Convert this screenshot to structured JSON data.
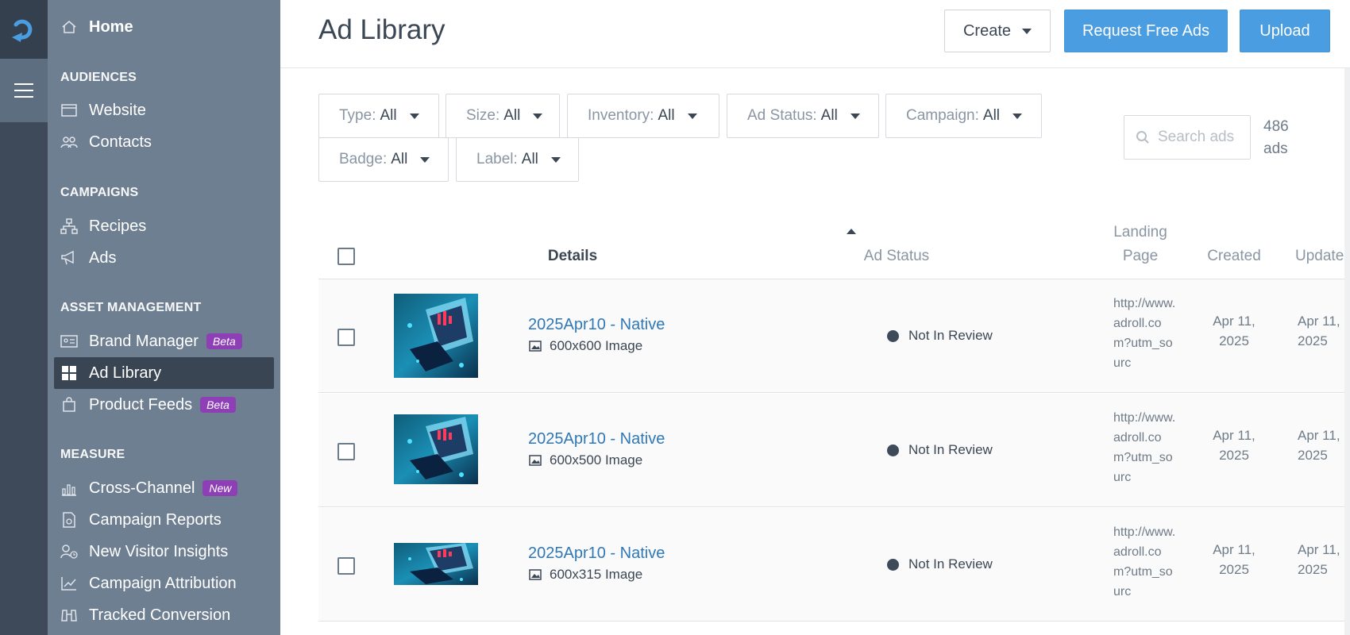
{
  "sidebar": {
    "home": "Home",
    "sections": {
      "audiences": "AUDIENCES",
      "campaigns": "CAMPAIGNS",
      "asset_management": "ASSET MANAGEMENT",
      "measure": "MEASURE"
    },
    "items": {
      "website": "Website",
      "contacts": "Contacts",
      "recipes": "Recipes",
      "ads": "Ads",
      "brand_manager": "Brand Manager",
      "ad_library": "Ad Library",
      "product_feeds": "Product Feeds",
      "cross_channel": "Cross-Channel",
      "campaign_reports": "Campaign Reports",
      "new_visitor_insights": "New Visitor Insights",
      "campaign_attribution": "Campaign Attribution",
      "tracked_conversion": "Tracked Conversion"
    },
    "badges": {
      "beta": "Beta",
      "new": "New"
    }
  },
  "header": {
    "title": "Ad Library",
    "create_label": "Create",
    "request_label": "Request Free Ads",
    "upload_label": "Upload"
  },
  "filters": [
    {
      "label": "Type:",
      "value": "All"
    },
    {
      "label": "Size:",
      "value": "All"
    },
    {
      "label": "Inventory:",
      "value": "All"
    },
    {
      "label": "Ad Status:",
      "value": "All"
    },
    {
      "label": "Campaign:",
      "value": "All"
    },
    {
      "label": "Badge:",
      "value": "All"
    },
    {
      "label": "Label:",
      "value": "All"
    }
  ],
  "search": {
    "placeholder": "Search ads"
  },
  "count": {
    "number": "486",
    "unit": "ads"
  },
  "table": {
    "columns": {
      "details": "Details",
      "status": "Ad Status",
      "landing_1": "Landing",
      "landing_2": "Page",
      "created": "Created",
      "updated": "Updated"
    },
    "rows": [
      {
        "name": "2025Apr10 - Native",
        "type": "600x600 Image",
        "status": "Not In Review",
        "landing": "http://www.adroll.com?utm_sourc",
        "created_1": "Apr 11,",
        "created_2": "2025",
        "updated_1": "Apr 11,",
        "updated_2": "2025"
      },
      {
        "name": "2025Apr10 - Native",
        "type": "600x500 Image",
        "status": "Not In Review",
        "landing": "http://www.adroll.com?utm_sourc",
        "created_1": "Apr 11,",
        "created_2": "2025",
        "updated_1": "Apr 11,",
        "updated_2": "2025"
      },
      {
        "name": "2025Apr10 - Native",
        "type": "600x315 Image",
        "status": "Not In Review",
        "landing": "http://www.adroll.com?utm_sourc",
        "created_1": "Apr 11,",
        "created_2": "2025",
        "updated_1": "Apr 11,",
        "updated_2": "2025"
      }
    ]
  },
  "colors": {
    "accent": "#4a9de0",
    "sidebar": "#6f7f92",
    "rail": "#3e4a59",
    "badge": "#8e3fb5",
    "link": "#2f78b8"
  }
}
